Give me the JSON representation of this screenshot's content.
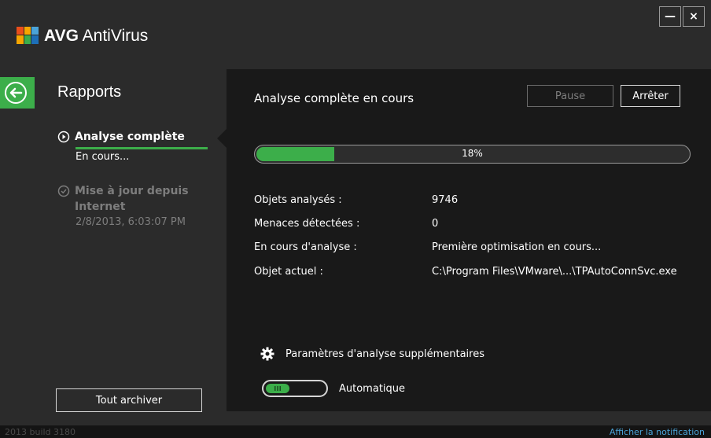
{
  "app": {
    "brand_bold": "AVG",
    "brand_rest": " AntiVirus"
  },
  "window": {
    "minimize": "—",
    "close": "×"
  },
  "sidebar": {
    "title": "Rapports",
    "items": [
      {
        "label": "Analyse complète",
        "sub": "En cours..."
      },
      {
        "label": "Mise à jour depuis Internet",
        "sub": "2/8/2013, 6:03:07 PM"
      }
    ],
    "archive_label": "Tout archiver"
  },
  "main": {
    "title": "Analyse complète en cours",
    "pause_label": "Pause",
    "stop_label": "Arrêter",
    "progress": {
      "value": 0.18,
      "label": "18%"
    },
    "stats": [
      {
        "key": "Objets analysés :",
        "value": "9746"
      },
      {
        "key": "Menaces détectées :",
        "value": "0"
      },
      {
        "key": "En cours d'analyse :",
        "value": "Première optimisation en cours..."
      },
      {
        "key": "Objet actuel :",
        "value": "C:\\Program Files\\VMware\\...\\TPAutoConnSvc.exe"
      }
    ],
    "settings_label": "Paramètres d'analyse supplémentaires",
    "toggle_label": "Automatique"
  },
  "footer": {
    "build": "2013  build 3180",
    "notification": "Afficher la notification"
  },
  "colors": {
    "accent": "#3cae4a",
    "link": "#4aa3d8",
    "panel": "#191919",
    "background": "#2b2b2b"
  }
}
